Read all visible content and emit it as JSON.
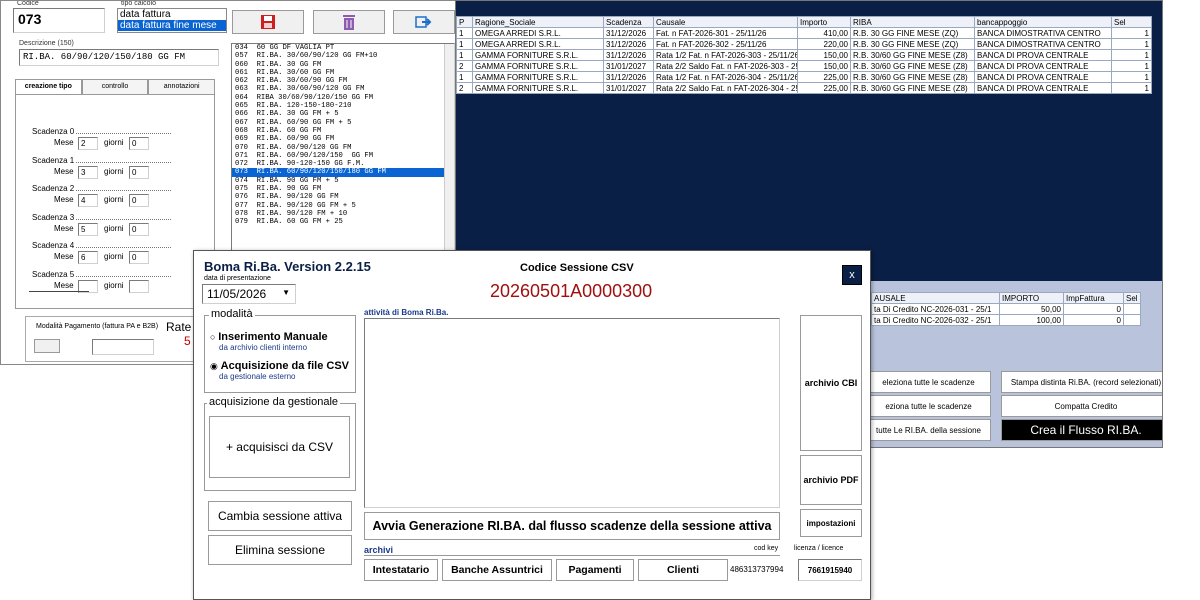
{
  "winA": {
    "codice_label": "Codice",
    "codice_value": "073",
    "tipo_calcolo_label": "tipo calcolo",
    "tipo_calcolo_options": [
      "data fattura",
      "data fattura fine mese"
    ],
    "descrizione_label": "Descrizione (150)",
    "descrizione_value": "RI.BA. 60/90/120/150/180 GG FM",
    "tabs": [
      "creazione tipo",
      "controllo",
      "annotazioni"
    ],
    "scadenze": [
      {
        "label": "Scadenza 0",
        "mese": "2",
        "giorni": "0"
      },
      {
        "label": "Scadenza 1",
        "mese": "3",
        "giorni": "0"
      },
      {
        "label": "Scadenza 2",
        "mese": "4",
        "giorni": "0"
      },
      {
        "label": "Scadenza 3",
        "mese": "5",
        "giorni": "0"
      },
      {
        "label": "Scadenza 4",
        "mese": "6",
        "giorni": "0"
      },
      {
        "label": "Scadenza 5",
        "mese": "",
        "giorni": ""
      }
    ],
    "mese_label": "Mese",
    "giorni_label": "giorni",
    "modalita_pagamento_label": "Modalità Pagamento (fattura PA e B2B)",
    "rate_label": "Rate",
    "rate_value": "5",
    "codes": [
      "034  60 GG DF VAGLIA PT",
      "057  RI.BA. 30/60/90/120 GG FM+10",
      "060  RI.BA. 30 GG FM",
      "061  RI.BA. 30/60 GG FM",
      "062  RI.BA. 30/60/90 GG FM",
      "063  RI.BA. 30/60/90/120 GG FM",
      "064  RIBA 30/60/90/120/150 GG FM",
      "065  RI.BA. 120-150-180-210",
      "066  RI.BA. 30 GG FM + 5",
      "067  RI.BA. 60/90 GG FM + 5",
      "068  RI.BA. 60 GG FM",
      "069  RI.BA. 60/90 GG FM",
      "070  RI.BA. 60/90/120 GG FM",
      "071  RI.BA. 60/90/120/150  GG FM",
      "072  RI.BA. 90-120-150 GG F.M.",
      "073  RI.BA. 60/90/120/150/180 GG FM",
      "074  RI.BA. 90 GG FM + 5",
      "075  RI.BA. 90 GG FM",
      "076  RI.BA. 90/120 GG FM",
      "077  RI.BA. 90/120 GG FM + 5",
      "078  RI.BA. 90/120 FM + 10",
      "079  RI.BA. 60 GG FM + 25"
    ],
    "selected_code_index": 15,
    "icons": [
      "save-icon",
      "trash-icon",
      "exit-icon"
    ],
    "colors": {
      "selection": "#0a64d2",
      "save_icon": "#cc1f1f",
      "trash_icon": "#8e5bb0",
      "exit_icon": "#1e6fc9",
      "rate_value": "#c00000"
    }
  },
  "winB": {
    "columns": [
      "P",
      "Ragione_Sociale",
      "Scadenza",
      "Causale",
      "Importo",
      "RIBA",
      "bancappoggio",
      "Sel"
    ],
    "rows": [
      [
        "1",
        "OMEGA ARREDI S.R.L.",
        "31/12/2026",
        "Fat. n FAT-2026-301 - 25/11/26",
        "410,00",
        "R.B. 30 GG FINE MESE (ZQ)",
        "BANCA DIMOSTRATIVA CENTRO",
        "1"
      ],
      [
        "1",
        "OMEGA ARREDI S.R.L.",
        "31/12/2026",
        "Fat. n FAT-2026-302 - 25/11/26",
        "220,00",
        "R.B. 30 GG FINE MESE (ZQ)",
        "BANCA DIMOSTRATIVA CENTRO",
        "1"
      ],
      [
        "1",
        "GAMMA FORNITURE S.R.L.",
        "31/12/2026",
        "Rata 1/2 Fat. n FAT-2026-303 - 25/11/26",
        "150,00",
        "R.B. 30/60 GG FINE MESE (Z8)",
        "BANCA DI PROVA CENTRALE",
        "1"
      ],
      [
        "2",
        "GAMMA FORNITURE S.R.L.",
        "31/01/2027",
        "Rata 2/2 Saldo Fat. n FAT-2026-303 - 2!",
        "150,00",
        "R.B. 30/60 GG FINE MESE (Z8)",
        "BANCA DI PROVA CENTRALE",
        "1"
      ],
      [
        "1",
        "GAMMA FORNITURE S.R.L.",
        "31/12/2026",
        "Rata 1/2 Fat. n FAT-2026-304 - 25/11/26",
        "225,00",
        "R.B. 30/60 GG FINE MESE (Z8)",
        "BANCA DI PROVA CENTRALE",
        "1"
      ],
      [
        "2",
        "GAMMA FORNITURE S.R.L.",
        "31/01/2027",
        "Rata 2/2 Saldo Fat. n FAT-2026-304 - 2!",
        "225,00",
        "R.B. 30/60 GG FINE MESE (Z8)",
        "BANCA DI PROVA CENTRALE",
        "1"
      ]
    ],
    "credit_columns": [
      "AUSALE",
      "IMPORTO",
      "ImpFattura",
      "Sel"
    ],
    "credit_rows": [
      [
        "ta Di Credito NC-2026-031 - 25/1",
        "50,00",
        "0",
        ""
      ],
      [
        "ta Di Credito NC-2026-032 - 25/1",
        "100,00",
        "0",
        ""
      ]
    ],
    "buttons": {
      "seleziona_tutte": "eleziona tutte le scadenze",
      "deseleziona_tutte": "eziona tutte le scadenze",
      "tutte_riba": "tutte Le RI.BA. della sessione",
      "stampa_distinta": "Stampa distinta Ri.BA. (record selezionati)",
      "compatta_credito": "Compatta Credito",
      "crea_flusso": "Crea il Flusso RI.BA."
    },
    "colors": {
      "background": "#0a1f45",
      "grid_header": "#eef2f8",
      "credit_panel": "#b9c4dc",
      "crea_button": "#000000"
    }
  },
  "winC": {
    "title": "Boma Ri.Ba. Version 2.2.15",
    "data_presentazione_label": "data di presentazione",
    "data_presentazione_value": "11/05/2026",
    "codice_sessione_label": "Codice Sessione CSV",
    "codice_sessione_value": "20260501A0000300",
    "close_label": "x",
    "modalita_label": "modalità",
    "modalita_options": [
      {
        "label": "Inserimento Manuale",
        "sub": "da archivio clienti interno",
        "checked": false
      },
      {
        "label": "Acquisizione da file CSV",
        "sub": "da gestionale esterno",
        "checked": true
      }
    ],
    "acquisizione_label": "acquisizione da gestionale",
    "acquisisci_btn": "+ acquisisci da CSV",
    "cambia_sessione_btn": "Cambia sessione attiva",
    "elimina_sessione_btn": "Elimina sessione",
    "attivita_label": "attività di Boma Ri.Ba.",
    "avvia_btn": "Avvia Generazione RI.BA. dal flusso scadenze della sessione attiva",
    "archivio_cbi_btn": "archivio CBI",
    "archivio_pdf_btn": "archivio PDF",
    "impostazioni_btn": "impostazioni",
    "archivi_label": "archivi",
    "archivi_buttons": [
      "Intestatario",
      "Banche Assuntrici",
      "Pagamenti",
      "Clienti"
    ],
    "cod_key_label": "cod key",
    "cod_key_value": "486313737994",
    "licenza_label": "licenza / licence",
    "licenza_value": "7661915940",
    "colors": {
      "session_code": "#a01010",
      "close_button": "#0a1f45"
    }
  }
}
